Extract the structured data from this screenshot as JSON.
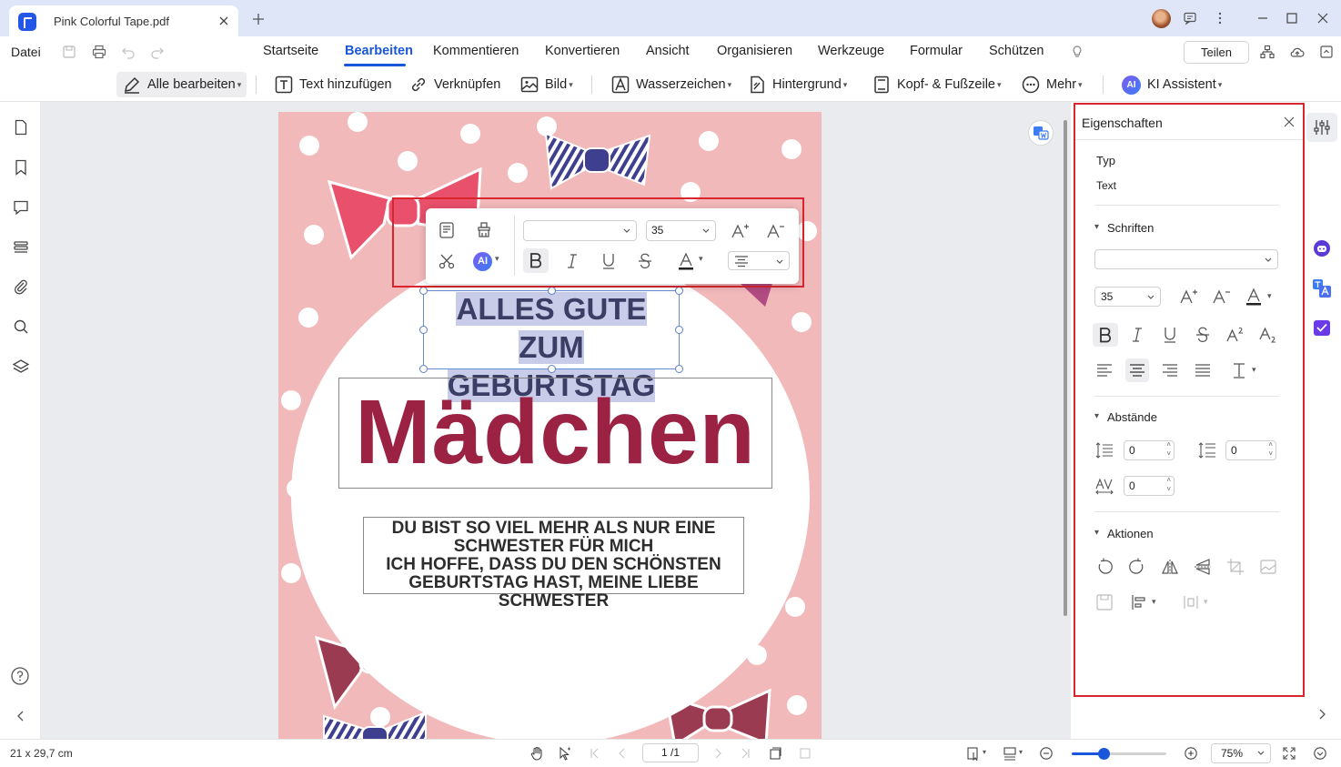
{
  "tab": {
    "title": "Pink Colorful Tape.pdf"
  },
  "menu": {
    "file": "Datei",
    "items": [
      "Startseite",
      "Bearbeiten",
      "Kommentieren",
      "Konvertieren",
      "Ansicht",
      "Organisieren",
      "Werkzeuge",
      "Formular",
      "Schützen"
    ],
    "active": "Bearbeiten",
    "share": "Teilen"
  },
  "toolbar": {
    "edit_all": "Alle bearbeiten",
    "add_text": "Text hinzufügen",
    "link": "Verknüpfen",
    "image": "Bild",
    "watermark": "Wasserzeichen",
    "background": "Hintergrund",
    "header_footer": "Kopf- & Fußzeile",
    "more": "Mehr",
    "ai_assistant": "KI Assistent",
    "ai_badge": "AI"
  },
  "document": {
    "heading_line1": "ALLES GUTE ZUM",
    "heading_line2": "GEBURTSTAG",
    "big_word": "Mädchen",
    "message_lines": [
      "DU BIST SO VIEL MEHR ALS NUR EINE",
      "SCHWESTER FÜR MICH",
      "ICH HOFFE, DASS DU DEN SCHÖNSTEN",
      "GEBURTSTAG HAST, MEINE LIEBE SCHWESTER"
    ]
  },
  "float_toolbar": {
    "font_size": "35",
    "ai_label": "AI"
  },
  "properties": {
    "title": "Eigenschaften",
    "type_label": "Typ",
    "type_value": "Text",
    "fonts_section": "Schriften",
    "font_size": "35",
    "spacing_section": "Abstände",
    "line_spacing": "0",
    "paragraph_spacing": "0",
    "char_spacing": "0",
    "actions_section": "Aktionen"
  },
  "status": {
    "page_size": "21 x 29,7 cm",
    "page_indicator": "1 /1",
    "zoom": "75%",
    "zoom_fraction": 0.34
  },
  "colors": {
    "accent": "#1a56db",
    "highlight_outline": "#d9262e",
    "page_pink": "#f2b9bb",
    "title_text": "#3a3d64",
    "big_word": "#9b2243"
  }
}
